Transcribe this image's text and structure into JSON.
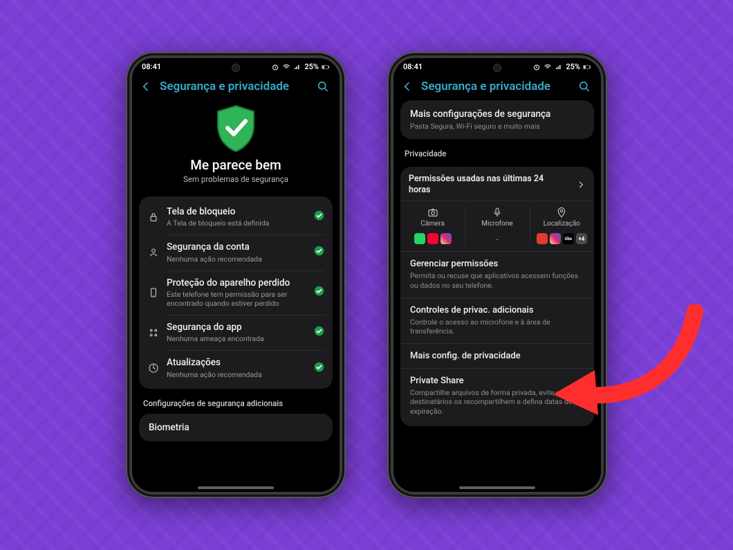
{
  "statusbar": {
    "time": "08:41",
    "battery": "25%"
  },
  "header": {
    "title": "Segurança e privacidade"
  },
  "left": {
    "status_title": "Me parece bem",
    "status_sub": "Sem problemas de segurança",
    "rows": [
      {
        "title": "Tela de bloqueio",
        "sub": "A Tela de bloqueio está definida"
      },
      {
        "title": "Segurança da conta",
        "sub": "Nenhuma ação recomendada"
      },
      {
        "title": "Proteção do aparelho perdido",
        "sub": "Este telefone tem permissão para ser encontrado quando estiver perdido"
      },
      {
        "title": "Segurança do app",
        "sub": "Nenhuma ameaça encontrada"
      },
      {
        "title": "Atualizações",
        "sub": "Nenhuma ação recomendada"
      }
    ],
    "extra_section": "Configurações de segurança adicionais",
    "biometria": "Biometria"
  },
  "right": {
    "top_card": {
      "title": "Mais configurações de segurança",
      "sub": "Pasta Segura, Wi-Fi seguro e muito mais"
    },
    "privacy_label": "Privacidade",
    "perm_title": "Permissões usadas nas últimas 24 horas",
    "perm_cols": {
      "camera": "Câmera",
      "mic": "Microfone",
      "loc": "Localização",
      "loc_plus": "+4",
      "mic_none": "-"
    },
    "rows": [
      {
        "title": "Gerenciar permissões",
        "sub": "Permita ou recuse que aplicativos acessem funções ou dados no seu telefone."
      },
      {
        "title": "Controles de privac. adicionais",
        "sub": "Controle o acesso ao microfone e à área de transferência."
      },
      {
        "title": "Mais config. de privacidade",
        "sub": ""
      },
      {
        "title": "Private Share",
        "sub": "Compartilhe arquivos de forma privada, evite que os destinatários os recompartilhem e defina datas de expiração."
      }
    ]
  }
}
